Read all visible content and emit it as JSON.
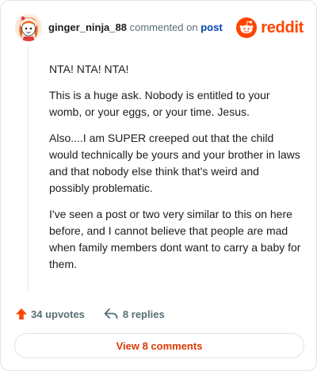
{
  "header": {
    "username": "ginger_ninja_88",
    "commented_on": "commented on",
    "post_link": "post",
    "brand": "reddit"
  },
  "comment": {
    "paragraphs": [
      "NTA! NTA! NTA!",
      "This is a huge ask. Nobody is entitled to your womb, or your eggs, or your time. Jesus.",
      "Also....I am SUPER creeped out that the child would technically be yours and your brother in laws and that nobody else think that's weird and possibly problematic.",
      "I've seen a post or two very similar to this on here before, and I cannot believe that people are mad when family members dont want to carry a baby for them."
    ]
  },
  "actions": {
    "upvotes": "34 upvotes",
    "replies": "8 replies",
    "upvote_icon": "arrow-up-icon",
    "reply_icon": "reply-arrow-icon"
  },
  "footer": {
    "view_comments": "View 8 comments"
  },
  "colors": {
    "brand": "#ff4500",
    "link": "#0045ac",
    "view_comments": "#d93a00"
  }
}
